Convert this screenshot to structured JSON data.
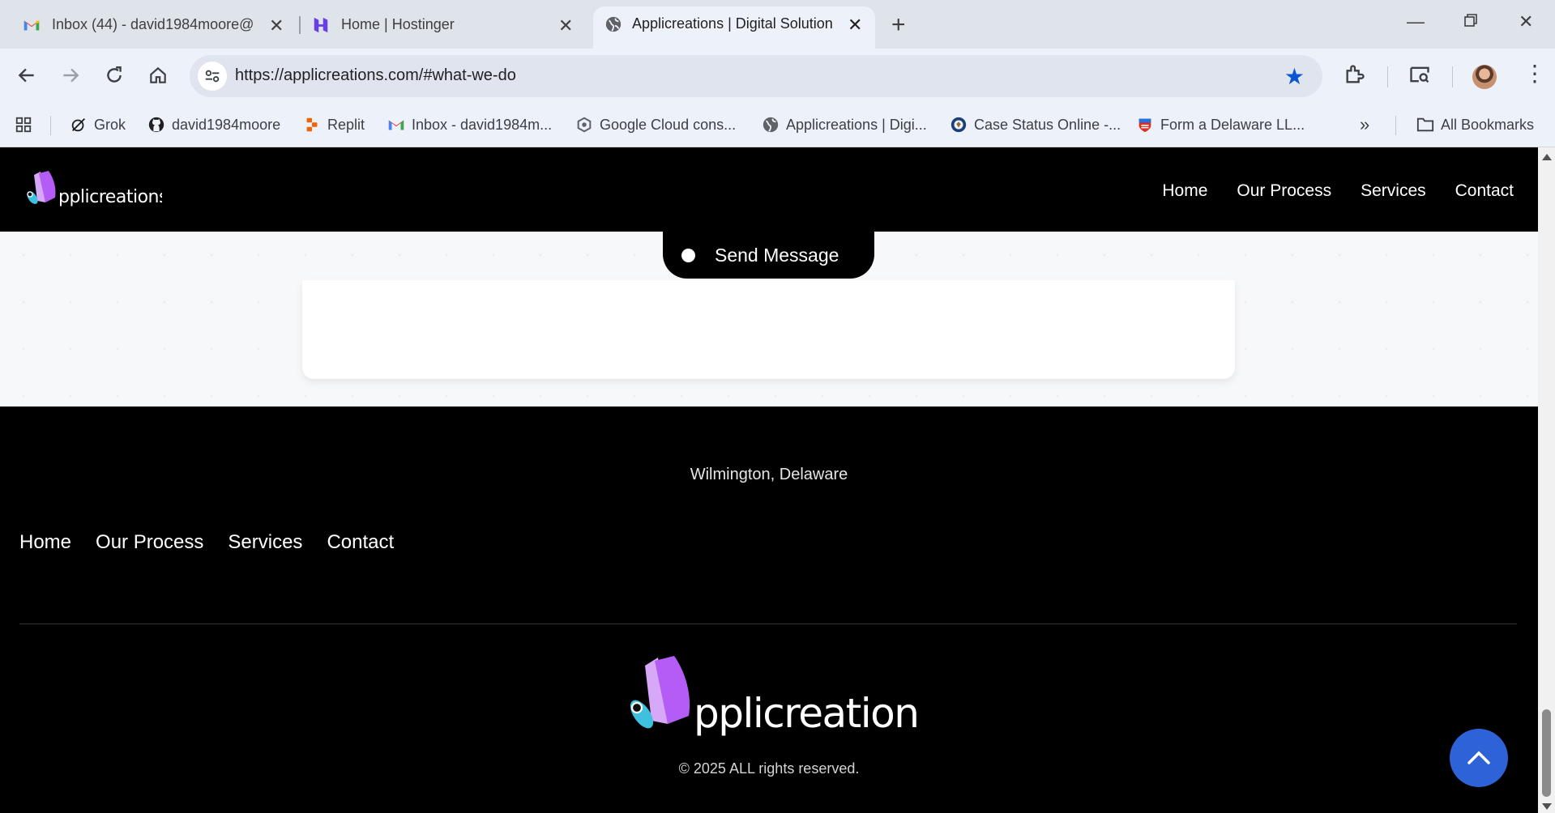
{
  "browser": {
    "tabs": [
      {
        "title": "Inbox (44) - david1984moore@",
        "icon": "gmail-icon"
      },
      {
        "title": "Home | Hostinger",
        "icon": "hostinger-icon"
      },
      {
        "title": "Applicreations | Digital Solution",
        "icon": "globe-icon",
        "active": true
      }
    ],
    "url": "https://applicreations.com/#what-we-do",
    "bookmarks": [
      {
        "label": "Grok",
        "icon": "grok-icon"
      },
      {
        "label": "david1984moore",
        "icon": "github-icon"
      },
      {
        "label": "Replit",
        "icon": "replit-icon"
      },
      {
        "label": "Inbox - david1984m...",
        "icon": "gmail-icon"
      },
      {
        "label": "Google Cloud cons...",
        "icon": "google-cloud-icon"
      },
      {
        "label": "Applicreations | Digi...",
        "icon": "globe-icon"
      },
      {
        "label": "Case Status Online -...",
        "icon": "uscis-seal-icon"
      },
      {
        "label": "Form a Delaware LL...",
        "icon": "delaware-icon"
      }
    ],
    "all_bookmarks_label": "All Bookmarks"
  },
  "site": {
    "logo_text": "pplicreations",
    "nav": [
      "Home",
      "Our Process",
      "Services",
      "Contact"
    ],
    "send_button_label": "Send Message",
    "footer": {
      "address": "Wilmington, Delaware",
      "nav": [
        "Home",
        "Our Process",
        "Services",
        "Contact"
      ],
      "copyright": "© 2025 ALL rights reserved."
    }
  },
  "colors": {
    "brand_purple": "#b45cf5",
    "brand_lavender": "#d7a8f8",
    "brand_cyan": "#3ec1de",
    "scroll_top_button": "#2e63d8",
    "star_blue": "#0b57d0"
  }
}
